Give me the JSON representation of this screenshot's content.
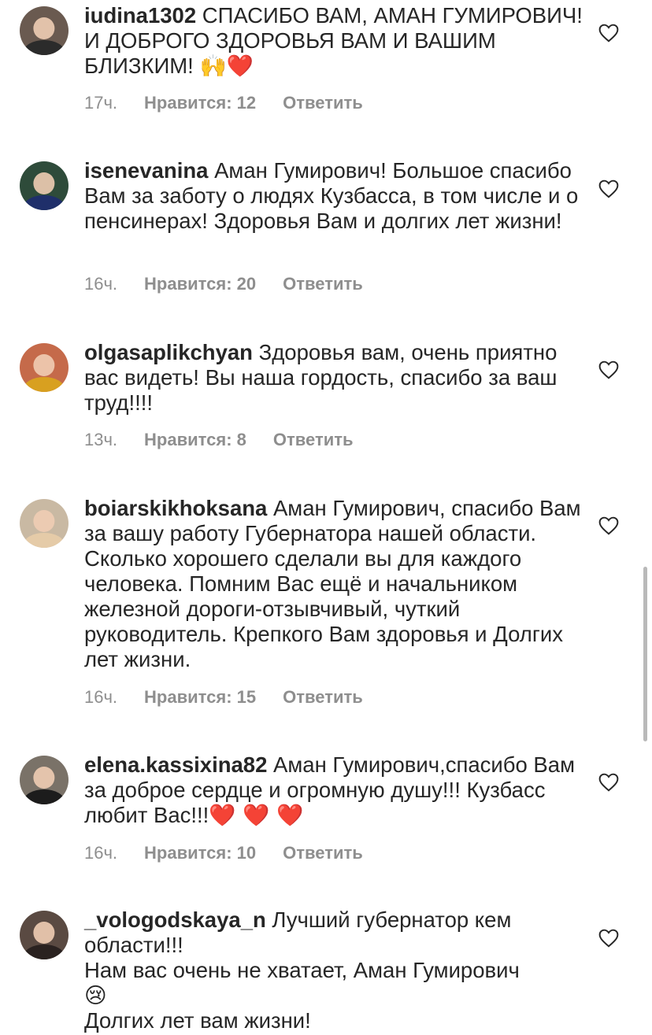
{
  "comments": [
    {
      "username": "iudina1302",
      "text": " СПАСИБО ВАМ,  АМАН ГУМИРОВИЧ! И ДОБРОГО ЗДОРОВЬЯ ВАМ И ВАШИМ БЛИЗКИМ! ",
      "emoji": "🙌❤️",
      "time": "17ч.",
      "likes": "Нравится: 12",
      "reply": "Ответить",
      "avatar_color": "#6a5a50"
    },
    {
      "username": "isenevanina",
      "text": " Аман Гумирович! Большое спасибо Вам за заботу о людях Кузбасса, в том числе и о пенсинерах! Здоровья Вам и долгих лет жизни!",
      "time": "16ч.",
      "likes": "Нравится: 20",
      "reply": "Ответить",
      "avatar_color": "#2e4b3a"
    },
    {
      "username": "olgasaplikchyan",
      "text": " Здоровья вам, очень приятно вас видеть! Вы наша гордость, спасибо за ваш труд!!!!",
      "time": "13ч.",
      "likes": "Нравится: 8",
      "reply": "Ответить",
      "avatar_color": "#c56a4a"
    },
    {
      "username": "boiarskikhoksana",
      "text": " Аман Гумирович, спасибо Вам за вашу работу Губернатора нашей области. Сколько хорошего сделали вы для каждого человека. Помним Вас ещё и начальником железной дороги-отзывчивый, чуткий руководитель. Крепкого Вам здоровья и Долгих лет жизни.",
      "time": "16ч.",
      "likes": "Нравится: 15",
      "reply": "Ответить",
      "avatar_color": "#c9b9a3"
    },
    {
      "username": "elena.kassixina82",
      "text": " Аман Гумирович,спасибо Вам за доброе сердце и огромную душу!!! Кузбасс любит Вас!!!",
      "emoji": "❤️ ❤️ ❤️",
      "time": "16ч.",
      "likes": "Нравится: 10",
      "reply": "Ответить",
      "avatar_color": "#7a7268"
    },
    {
      "username": "_vologodskaya_n",
      "text": " Лучший губернатор кем области!!!",
      "line2": "Нам вас очень не хватает, Аман Гумирович",
      "emoji": "😢",
      "line3": "Долгих лет вам жизни!",
      "avatar_color": "#5a4a42"
    }
  ]
}
